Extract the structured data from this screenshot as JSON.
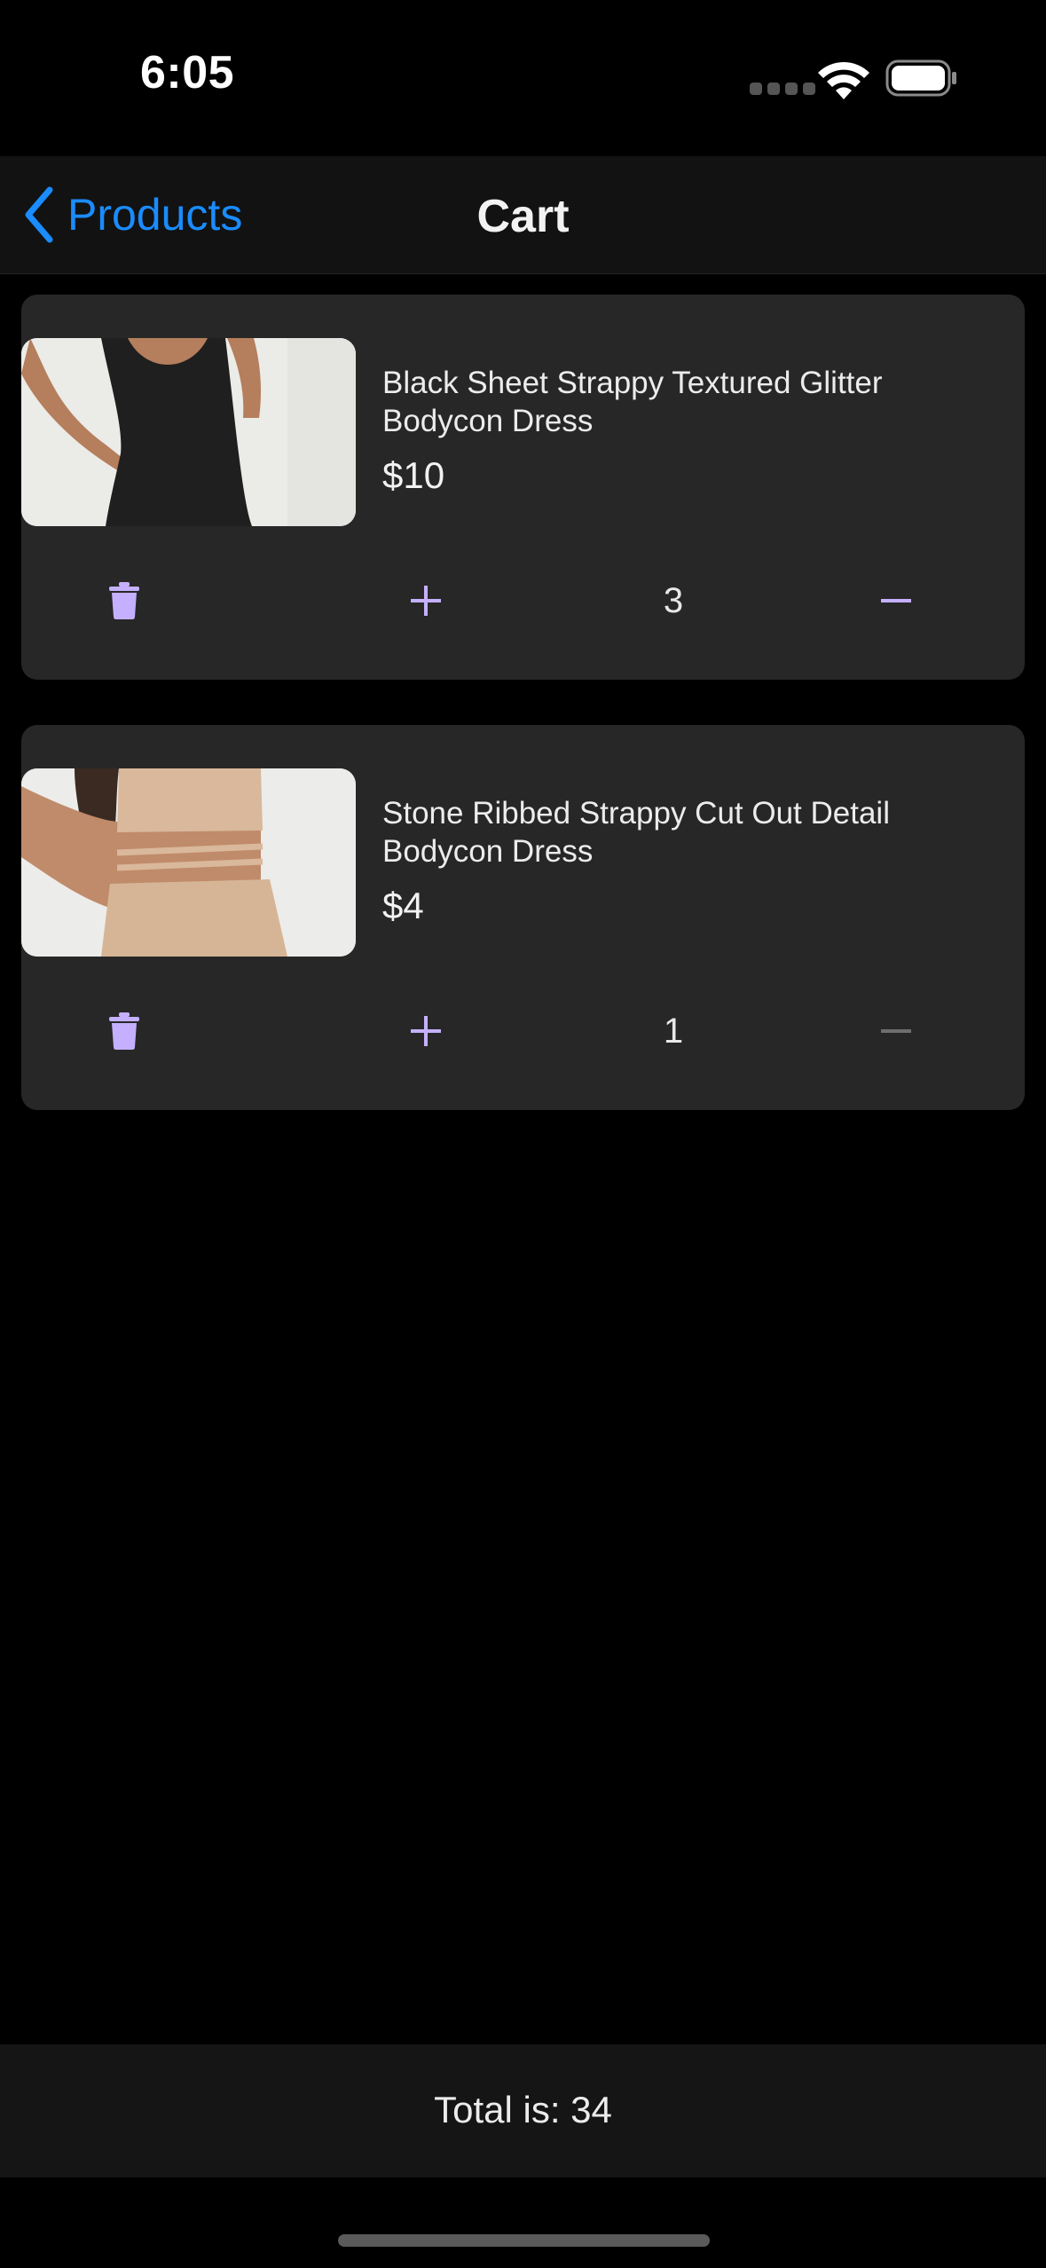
{
  "status_bar": {
    "time": "6:05"
  },
  "nav": {
    "back_label": "Products",
    "title": "Cart"
  },
  "cart": {
    "items": [
      {
        "name": "Black Sheet Strappy Textured Glitter Bodycon Dress",
        "price": "$10",
        "quantity": "3",
        "decrement_enabled": true
      },
      {
        "name": "Stone Ribbed Strappy Cut Out Detail Bodycon Dress",
        "price": "$4",
        "quantity": "1",
        "decrement_enabled": false
      }
    ]
  },
  "footer": {
    "total": "Total is: 34"
  },
  "colors": {
    "accent": "#1a8cff",
    "control": "#c4b0ff",
    "disabled": "#6e6e6e",
    "card": "#272727"
  },
  "icons": [
    "chevron-left-icon",
    "trash-icon",
    "plus-icon",
    "minus-icon",
    "wifi-icon",
    "battery-icon",
    "signal-icon"
  ]
}
